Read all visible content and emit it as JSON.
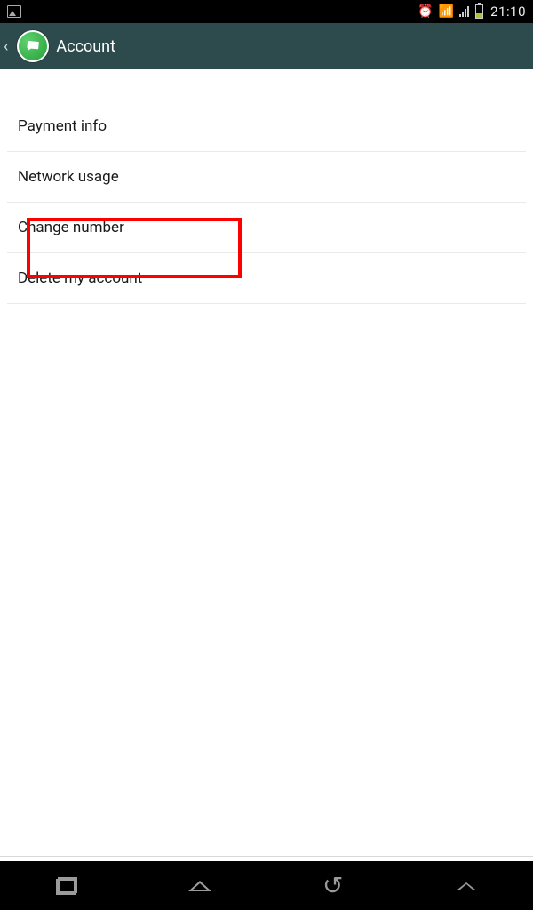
{
  "status": {
    "time": "21:10"
  },
  "header": {
    "title": "Account"
  },
  "menu": {
    "items": [
      {
        "label": "Payment info"
      },
      {
        "label": "Network usage"
      },
      {
        "label": "Change number"
      },
      {
        "label": "Delete my account"
      }
    ]
  },
  "highlight": {
    "target_index": 2
  }
}
